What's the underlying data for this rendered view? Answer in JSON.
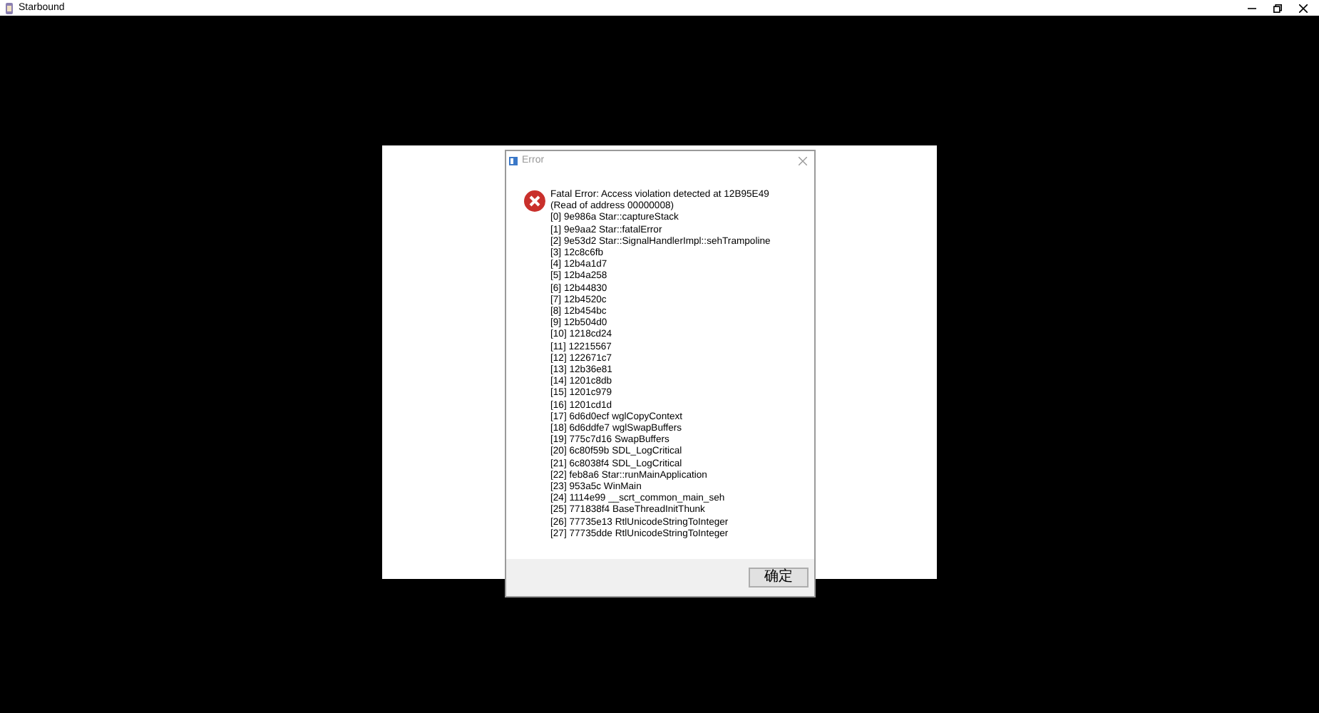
{
  "window": {
    "title": "Starbound"
  },
  "dialog": {
    "title": "Error",
    "message": "Fatal Error: Access violation detected at 12B95E49 (Read of address 00000008)",
    "stack": [
      "[0] 9e986a Star::captureStack",
      "[1] 9e9aa2 Star::fatalError",
      "[2] 9e53d2 Star::SignalHandlerImpl::sehTrampoline",
      "[3] 12c8c6fb",
      "[4] 12b4a1d7",
      "[5] 12b4a258",
      "[6] 12b44830",
      "[7] 12b4520c",
      "[8] 12b454bc",
      "[9] 12b504d0",
      "[10] 1218cd24",
      "[11] 12215567",
      "[12] 122671c7",
      "[13] 12b36e81",
      "[14] 1201c8db",
      "[15] 1201c979",
      "[16] 1201cd1d",
      "[17] 6d6d0ecf wglCopyContext",
      "[18] 6d6ddfe7 wglSwapBuffers",
      "[19] 775c7d16 SwapBuffers",
      "[20] 6c80f59b SDL_LogCritical",
      "[21] 6c8038f4 SDL_LogCritical",
      "[22] feb8a6 Star::runMainApplication",
      "[23] 953a5c WinMain",
      "[24] 1114e99 __scrt_common_main_seh",
      "[25] 771838f4 BaseThreadInitThunk",
      "[26] 77735e13 RtlUnicodeStringToInteger",
      "[27] 77735dde RtlUnicodeStringToInteger"
    ],
    "buttons": [
      "确定"
    ]
  }
}
